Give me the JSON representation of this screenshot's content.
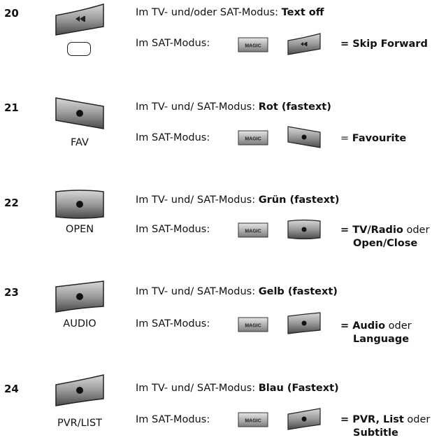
{
  "entries": [
    {
      "number": "20",
      "button_icon": "skip-forward-icon",
      "button_label": "",
      "line1_prefix": "Im TV- und/oder SAT-Modus: ",
      "line1_bold": "Text off",
      "line2_prefix": "Im SAT-Modus:",
      "magic_label": "MAGIC",
      "result_eq": "= ",
      "result_bold1": "Skip Forward",
      "result_plain": "",
      "result_bold2": ""
    },
    {
      "number": "21",
      "button_icon": "dot-icon",
      "button_label": "FAV",
      "line1_prefix": "Im TV- und/ SAT-Modus: ",
      "line1_bold": "Rot (fastext)",
      "line2_prefix": "Im SAT-Modus:",
      "magic_label": "MAGIC",
      "result_eq": "= ",
      "result_bold1": "Favourite",
      "result_plain": "",
      "result_bold2": ""
    },
    {
      "number": "22",
      "button_icon": "dot-icon",
      "button_label": "OPEN",
      "line1_prefix": "Im TV- und/ SAT-Modus: ",
      "line1_bold": "Grün (fastext)",
      "line2_prefix": "Im SAT-Modus:",
      "magic_label": "MAGIC",
      "result_eq": "= ",
      "result_bold1": "TV/Radio",
      "result_plain": " oder",
      "result_bold2": "Open/Close"
    },
    {
      "number": "23",
      "button_icon": "dot-icon",
      "button_label": "AUDIO",
      "line1_prefix": "Im TV- und/ SAT-Modus: ",
      "line1_bold": "Gelb (fastext)",
      "line2_prefix": "Im SAT-Modus:",
      "magic_label": "MAGIC",
      "result_eq": "= ",
      "result_bold1": "Audio",
      "result_plain": " oder",
      "result_bold2": "Language"
    },
    {
      "number": "24",
      "button_icon": "dot-icon",
      "button_label": "PVR/LIST",
      "line1_prefix": "Im TV- und/ SAT-Modus: ",
      "line1_bold": "Blau (Fastext)",
      "line2_prefix": "Im SAT-Modus:",
      "magic_label": "MAGIC",
      "result_eq": "= ",
      "result_bold1": "PVR, List",
      "result_plain": " oder",
      "result_bold2": "Subtitle"
    }
  ]
}
